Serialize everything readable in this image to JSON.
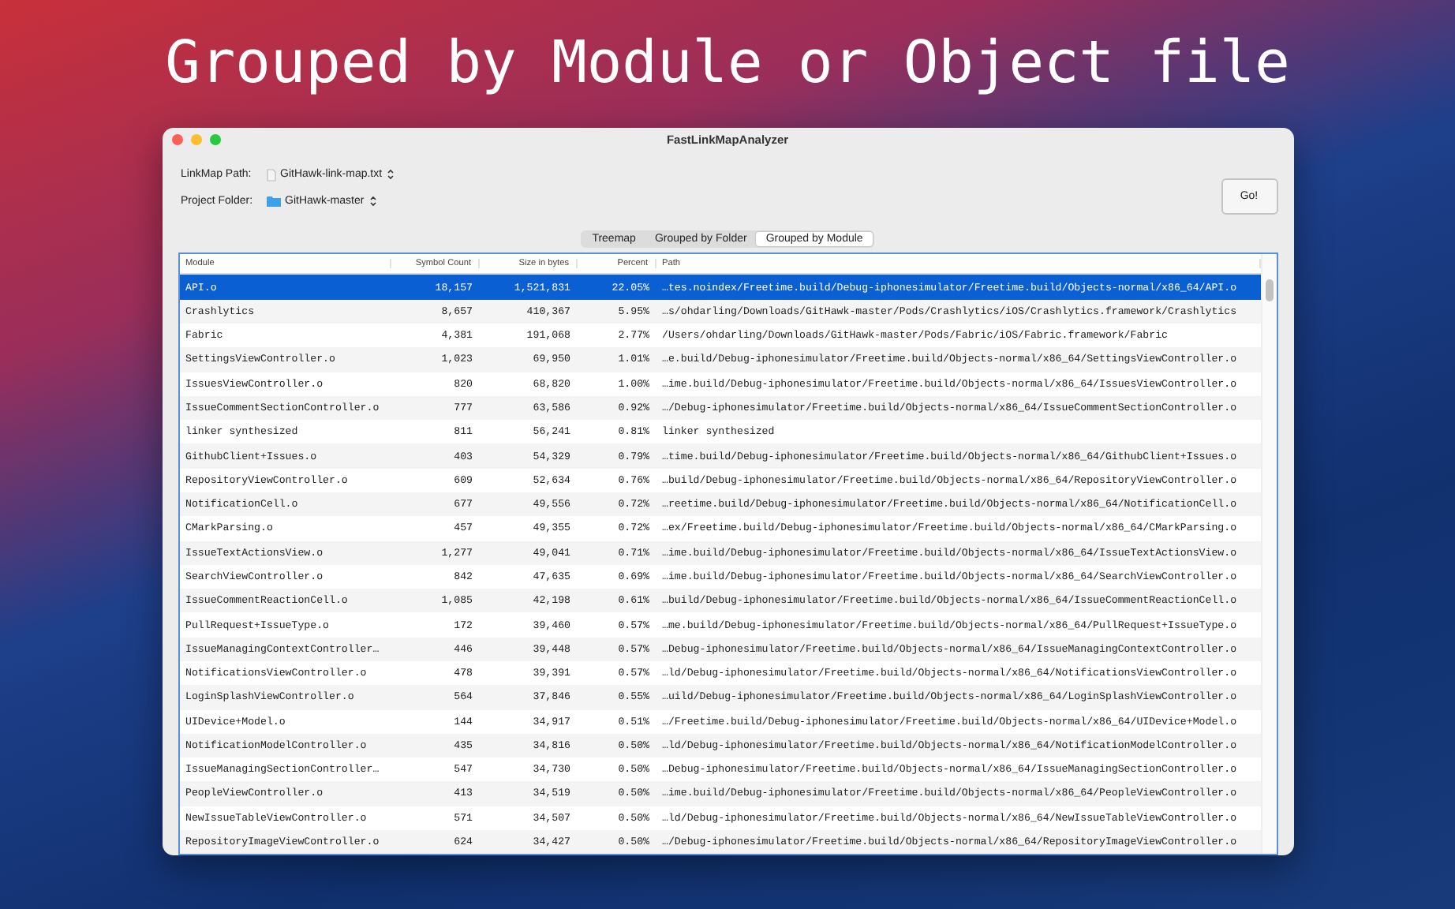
{
  "headline": "Grouped by Module or Object file",
  "window": {
    "title": "FastLinkMapAnalyzer"
  },
  "form": [
    {
      "label": "LinkMap Path:",
      "value": "GitHawk-link-map.txt",
      "kind": "file"
    },
    {
      "label": "Project Folder:",
      "value": "GitHawk-master",
      "kind": "folder"
    }
  ],
  "go_button": "Go!",
  "tabs": [
    {
      "label": "Treemap",
      "selected": false
    },
    {
      "label": "Grouped by Folder",
      "selected": false
    },
    {
      "label": "Grouped by Module",
      "selected": true
    }
  ],
  "table": {
    "columns": [
      "Module",
      "Symbol Count",
      "Size in bytes",
      "Percent",
      "Path"
    ],
    "rows": [
      {
        "selected": true,
        "cells": [
          "API.o",
          "18,157",
          "1,521,831",
          "22.05%",
          "…tes.noindex/Freetime.build/Debug-iphonesimulator/Freetime.build/Objects-normal/x86_64/API.o"
        ]
      },
      {
        "selected": false,
        "cells": [
          "Crashlytics",
          "8,657",
          "410,367",
          "5.95%",
          "…s/ohdarling/Downloads/GitHawk-master/Pods/Crashlytics/iOS/Crashlytics.framework/Crashlytics"
        ]
      },
      {
        "selected": false,
        "cells": [
          "Fabric",
          "4,381",
          "191,068",
          "2.77%",
          "/Users/ohdarling/Downloads/GitHawk-master/Pods/Fabric/iOS/Fabric.framework/Fabric"
        ]
      },
      {
        "selected": false,
        "cells": [
          "SettingsViewController.o",
          "1,023",
          "69,950",
          "1.01%",
          "…e.build/Debug-iphonesimulator/Freetime.build/Objects-normal/x86_64/SettingsViewController.o"
        ]
      },
      {
        "selected": false,
        "cells": [
          "IssuesViewController.o",
          "820",
          "68,820",
          "1.00%",
          "…ime.build/Debug-iphonesimulator/Freetime.build/Objects-normal/x86_64/IssuesViewController.o"
        ]
      },
      {
        "selected": false,
        "cells": [
          "IssueCommentSectionController.o",
          "777",
          "63,586",
          "0.92%",
          "…/Debug-iphonesimulator/Freetime.build/Objects-normal/x86_64/IssueCommentSectionController.o"
        ]
      },
      {
        "selected": false,
        "cells": [
          "linker synthesized",
          "811",
          "56,241",
          "0.81%",
          "linker synthesized"
        ]
      },
      {
        "selected": false,
        "cells": [
          "GithubClient+Issues.o",
          "403",
          "54,329",
          "0.79%",
          "…time.build/Debug-iphonesimulator/Freetime.build/Objects-normal/x86_64/GithubClient+Issues.o"
        ]
      },
      {
        "selected": false,
        "cells": [
          "RepositoryViewController.o",
          "609",
          "52,634",
          "0.76%",
          "…build/Debug-iphonesimulator/Freetime.build/Objects-normal/x86_64/RepositoryViewController.o"
        ]
      },
      {
        "selected": false,
        "cells": [
          "NotificationCell.o",
          "677",
          "49,556",
          "0.72%",
          "…reetime.build/Debug-iphonesimulator/Freetime.build/Objects-normal/x86_64/NotificationCell.o"
        ]
      },
      {
        "selected": false,
        "cells": [
          "CMarkParsing.o",
          "457",
          "49,355",
          "0.72%",
          "…ex/Freetime.build/Debug-iphonesimulator/Freetime.build/Objects-normal/x86_64/CMarkParsing.o"
        ]
      },
      {
        "selected": false,
        "cells": [
          "IssueTextActionsView.o",
          "1,277",
          "49,041",
          "0.71%",
          "…ime.build/Debug-iphonesimulator/Freetime.build/Objects-normal/x86_64/IssueTextActionsView.o"
        ]
      },
      {
        "selected": false,
        "cells": [
          "SearchViewController.o",
          "842",
          "47,635",
          "0.69%",
          "…ime.build/Debug-iphonesimulator/Freetime.build/Objects-normal/x86_64/SearchViewController.o"
        ]
      },
      {
        "selected": false,
        "cells": [
          "IssueCommentReactionCell.o",
          "1,085",
          "42,198",
          "0.61%",
          "…build/Debug-iphonesimulator/Freetime.build/Objects-normal/x86_64/IssueCommentReactionCell.o"
        ]
      },
      {
        "selected": false,
        "cells": [
          "PullRequest+IssueType.o",
          "172",
          "39,460",
          "0.57%",
          "…me.build/Debug-iphonesimulator/Freetime.build/Objects-normal/x86_64/PullRequest+IssueType.o"
        ]
      },
      {
        "selected": false,
        "cells": [
          "IssueManagingContextController…",
          "446",
          "39,448",
          "0.57%",
          "…Debug-iphonesimulator/Freetime.build/Objects-normal/x86_64/IssueManagingContextController.o"
        ]
      },
      {
        "selected": false,
        "cells": [
          "NotificationsViewController.o",
          "478",
          "39,391",
          "0.57%",
          "…ld/Debug-iphonesimulator/Freetime.build/Objects-normal/x86_64/NotificationsViewController.o"
        ]
      },
      {
        "selected": false,
        "cells": [
          "LoginSplashViewController.o",
          "564",
          "37,846",
          "0.55%",
          "…uild/Debug-iphonesimulator/Freetime.build/Objects-normal/x86_64/LoginSplashViewController.o"
        ]
      },
      {
        "selected": false,
        "cells": [
          "UIDevice+Model.o",
          "144",
          "34,917",
          "0.51%",
          "…/Freetime.build/Debug-iphonesimulator/Freetime.build/Objects-normal/x86_64/UIDevice+Model.o"
        ]
      },
      {
        "selected": false,
        "cells": [
          "NotificationModelController.o",
          "435",
          "34,816",
          "0.50%",
          "…ld/Debug-iphonesimulator/Freetime.build/Objects-normal/x86_64/NotificationModelController.o"
        ]
      },
      {
        "selected": false,
        "cells": [
          "IssueManagingSectionController…",
          "547",
          "34,730",
          "0.50%",
          "…Debug-iphonesimulator/Freetime.build/Objects-normal/x86_64/IssueManagingSectionController.o"
        ]
      },
      {
        "selected": false,
        "cells": [
          "PeopleViewController.o",
          "413",
          "34,519",
          "0.50%",
          "…ime.build/Debug-iphonesimulator/Freetime.build/Objects-normal/x86_64/PeopleViewController.o"
        ]
      },
      {
        "selected": false,
        "cells": [
          "NewIssueTableViewController.o",
          "571",
          "34,507",
          "0.50%",
          "…ld/Debug-iphonesimulator/Freetime.build/Objects-normal/x86_64/NewIssueTableViewController.o"
        ]
      },
      {
        "selected": false,
        "cells": [
          "RepositoryImageViewController.o",
          "624",
          "34,427",
          "0.50%",
          "…/Debug-iphonesimulator/Freetime.build/Objects-normal/x86_64/RepositoryImageViewController.o"
        ]
      }
    ]
  }
}
